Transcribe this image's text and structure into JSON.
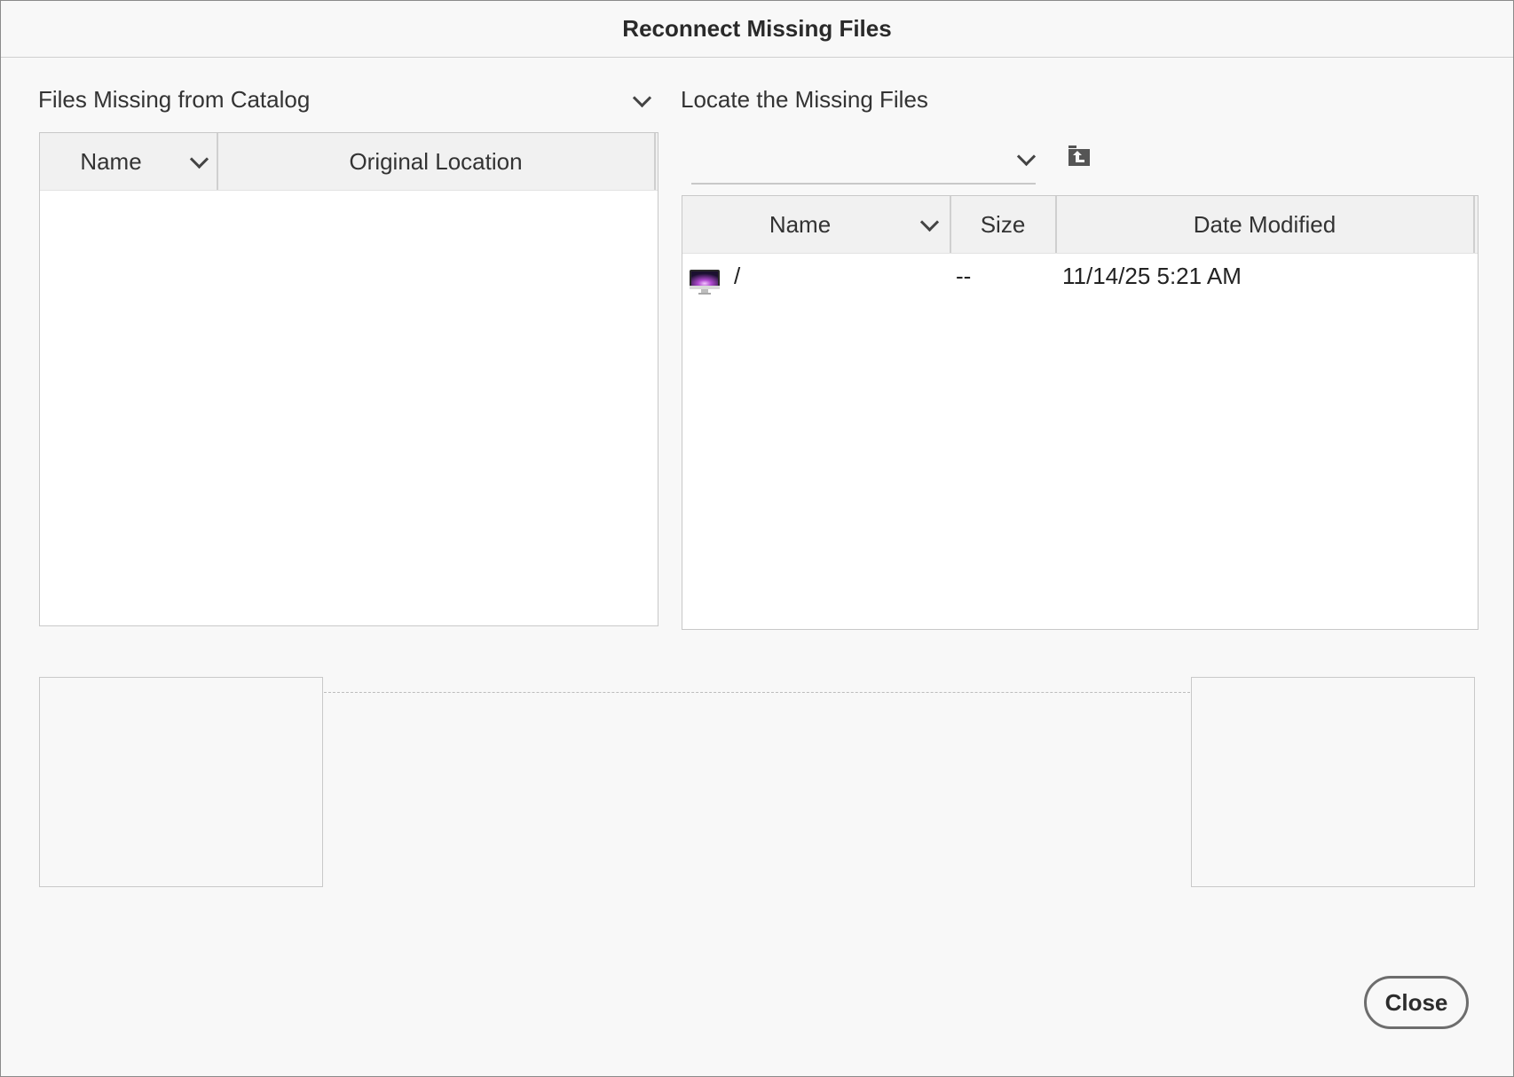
{
  "window": {
    "title": "Reconnect Missing Files"
  },
  "left": {
    "section_title": "Files Missing from Catalog",
    "columns": {
      "name": "Name",
      "original_location": "Original Location"
    },
    "rows": []
  },
  "right": {
    "section_title": "Locate the Missing Files",
    "path_value": "",
    "columns": {
      "name": "Name",
      "size": "Size",
      "date_modified": "Date Modified"
    },
    "rows": [
      {
        "icon": "computer-icon",
        "name": "/",
        "size": "--",
        "date_modified": "11/14/25 5:21 AM"
      }
    ]
  },
  "buttons": {
    "close": "Close"
  },
  "icons": {
    "section_menu": "chevron-down-icon",
    "path_dropdown": "chevron-down-icon",
    "folder_up": "folder-up-icon"
  }
}
